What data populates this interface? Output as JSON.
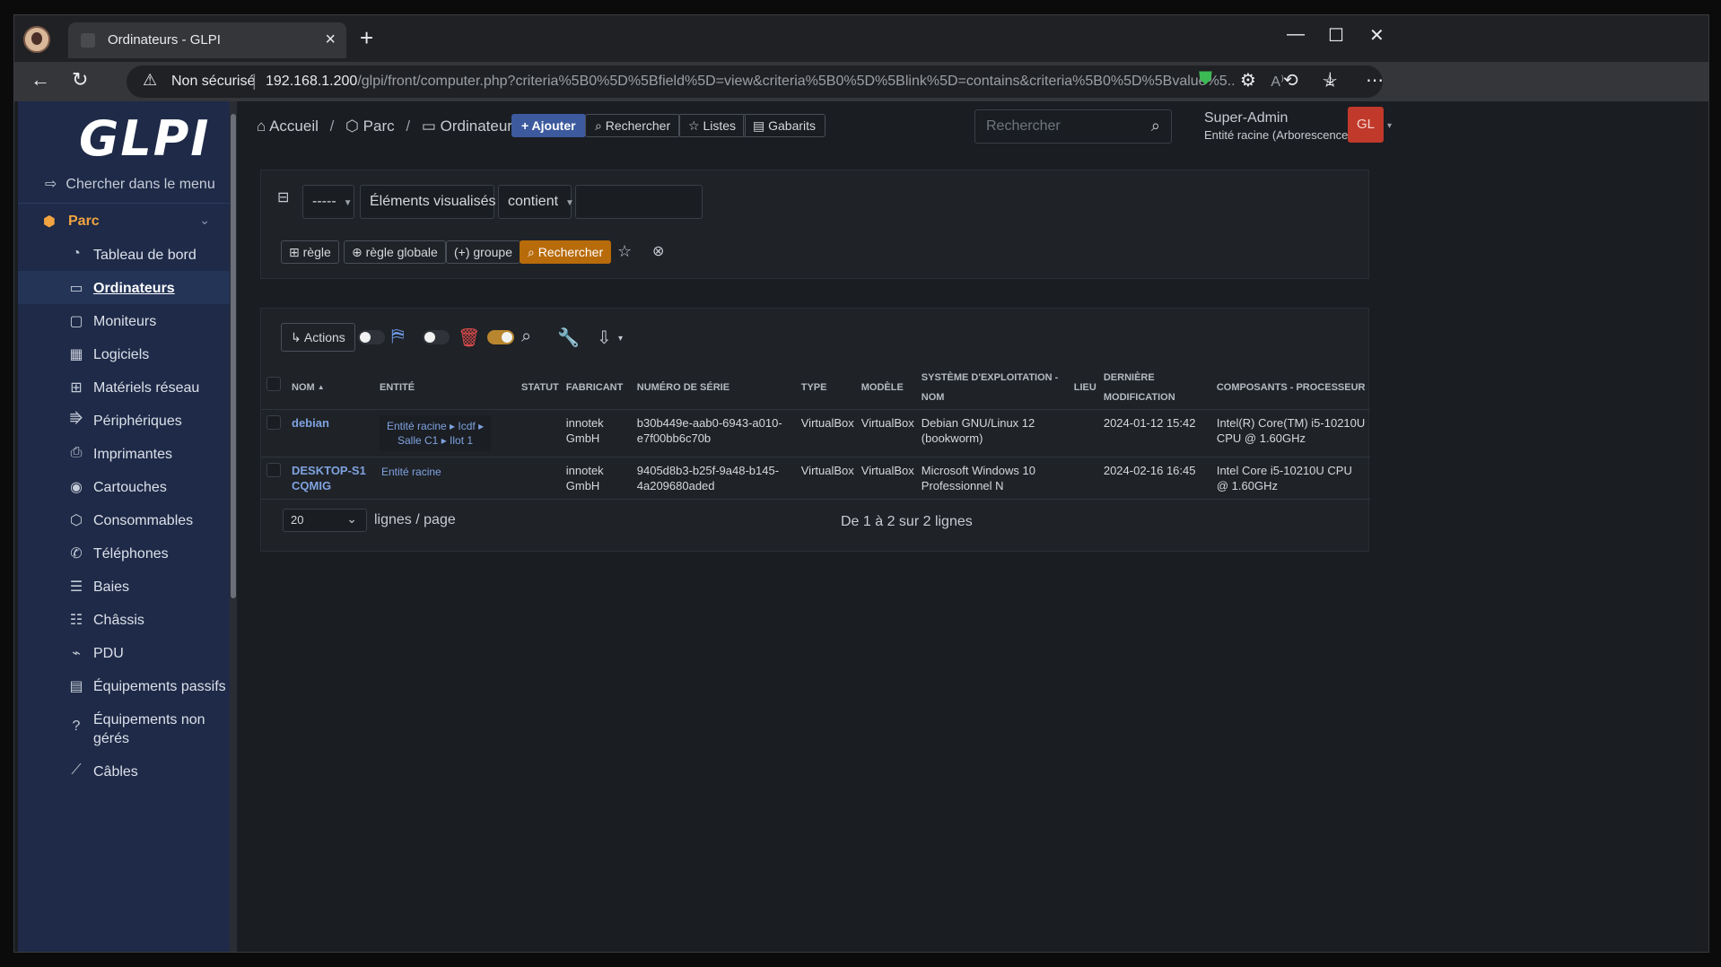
{
  "browser": {
    "tab_title": "Ordinateurs - GLPI",
    "security_label": "Non sécurisé",
    "url_host": "192.168.1.200",
    "url_path": "/glpi/front/computer.php?criteria%5B0%5D%5Bfield%5D=view&criteria%5B0%5D%5Blink%5D=contains&criteria%5B0%5D%5Bvalue%5..."
  },
  "sidebar": {
    "logo": "GLPI",
    "menu_search": "Chercher dans le menu",
    "section": "Parc",
    "items": [
      {
        "label": "Tableau de bord",
        "icon": "gauge-icon"
      },
      {
        "label": "Ordinateurs",
        "icon": "laptop-icon"
      },
      {
        "label": "Moniteurs",
        "icon": "monitor-icon"
      },
      {
        "label": "Logiciels",
        "icon": "apps-icon"
      },
      {
        "label": "Matériels réseau",
        "icon": "network-icon"
      },
      {
        "label": "Périphériques",
        "icon": "usb-icon"
      },
      {
        "label": "Imprimantes",
        "icon": "printer-icon"
      },
      {
        "label": "Cartouches",
        "icon": "droplet-icon"
      },
      {
        "label": "Consommables",
        "icon": "box-icon"
      },
      {
        "label": "Téléphones",
        "icon": "phone-icon"
      },
      {
        "label": "Baies",
        "icon": "server-icon"
      },
      {
        "label": "Châssis",
        "icon": "chassis-icon"
      },
      {
        "label": "PDU",
        "icon": "plug-icon"
      },
      {
        "label": "Équipements passifs",
        "icon": "device-icon"
      },
      {
        "label": "Équipements non gérés",
        "icon": "question-icon"
      },
      {
        "label": "Câbles",
        "icon": "cable-icon"
      }
    ]
  },
  "header": {
    "breadcrumb": [
      "Accueil",
      "Parc",
      "Ordinateurs"
    ],
    "buttons": {
      "add": "Ajouter",
      "search": "Rechercher",
      "lists": "Listes",
      "templates": "Gabarits"
    },
    "search_placeholder": "Rechercher",
    "user_name": "Super-Admin",
    "user_entity": "Entité racine (Arborescence)",
    "avatar_initials": "GL"
  },
  "criteria": {
    "link": "-----",
    "field": "Éléments visualisés",
    "operator": "contient",
    "value": "",
    "buttons": {
      "rule": "règle",
      "global_rule": "règle globale",
      "group": "groupe",
      "search": "Rechercher"
    }
  },
  "results": {
    "actions_label": "Actions",
    "columns": [
      "Nom",
      "Entité",
      "Statut",
      "Fabricant",
      "Numéro de série",
      "Type",
      "Modèle",
      "Système d'exploitation - Nom",
      "Lieu",
      "Dernière modification",
      "Composants - Processeur"
    ],
    "rows": [
      {
        "name": "debian",
        "entity_line1": "Entité racine ▸ Icdf ▸",
        "entity_line2": "Salle C1 ▸ Ilot 1",
        "status": "",
        "manufacturer": "innotek GmbH",
        "serial": "b30b449e-aab0-6943-a010-e7f00bb6c70b",
        "type": "VirtualBox",
        "model": "VirtualBox",
        "os": "Debian GNU/Linux 12 (bookworm)",
        "location": "",
        "modified": "2024-01-12 15:42",
        "cpu": "Intel(R) Core(TM) i5-10210U CPU @ 1.60GHz"
      },
      {
        "name": "DESKTOP-S1CQMIG",
        "entity_line1": "Entité racine",
        "entity_line2": "",
        "status": "",
        "manufacturer": "innotek GmbH",
        "serial": "9405d8b3-b25f-9a48-b145-4a209680aded",
        "type": "VirtualBox",
        "model": "VirtualBox",
        "os": "Microsoft Windows 10 Professionnel N",
        "location": "",
        "modified": "2024-02-16 16:45",
        "cpu": "Intel Core i5-10210U CPU @ 1.60GHz"
      }
    ],
    "per_page": "20",
    "per_page_label": "lignes / page",
    "pagination_info": "De 1 à 2 sur 2 lignes"
  }
}
